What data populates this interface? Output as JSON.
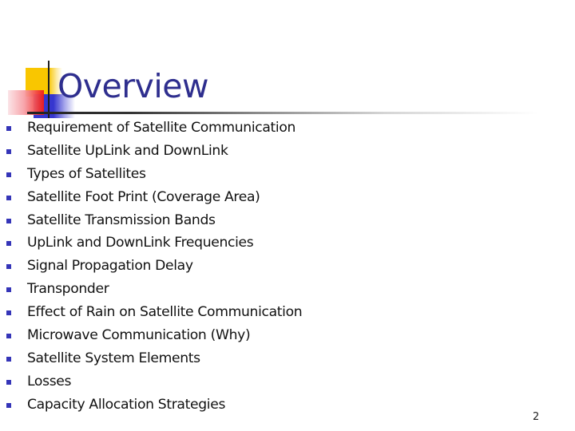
{
  "slide": {
    "title": "Overview",
    "bullets": [
      "Requirement of Satellite Communication",
      "Satellite UpLink and DownLink",
      "Types of Satellites",
      "Satellite Foot Print (Coverage Area)",
      "Satellite Transmission Bands",
      "UpLink and DownLink Frequencies",
      "Signal Propagation Delay",
      "Transponder",
      "Effect of Rain on Satellite Communication",
      "Microwave Communication (Why)",
      "Satellite System Elements",
      "Losses",
      "Capacity Allocation Strategies"
    ],
    "page_number": "2",
    "bullet_icon": "square-bullet-icon"
  },
  "colors": {
    "title": "#2e2e8e",
    "bullet": "#3535b8",
    "body_text": "#111111",
    "deco_yellow": "#f9c600",
    "deco_blue": "#3535cf",
    "deco_red": "#f01a1a"
  }
}
